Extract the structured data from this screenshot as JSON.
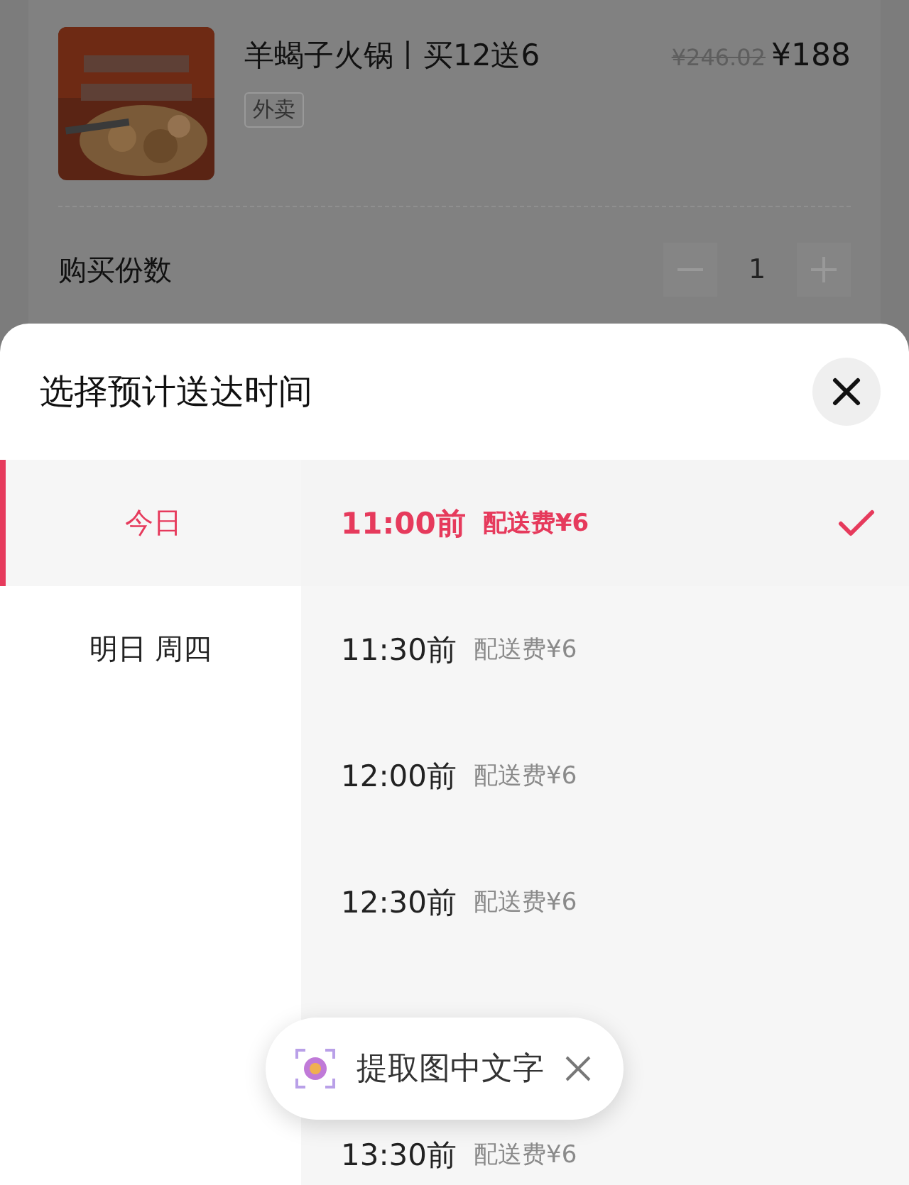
{
  "product": {
    "title": "羊蝎子火锅丨买12送6",
    "original_price": "¥246.02",
    "price": "¥188",
    "tag": "外卖"
  },
  "quantity": {
    "label": "购买份数",
    "value": "1"
  },
  "sheet": {
    "title": "选择预计送达时间",
    "days": [
      {
        "label": "今日",
        "selected": true
      },
      {
        "label": "明日 周四",
        "selected": false
      }
    ],
    "slots": [
      {
        "kind": "slot",
        "time": "11:00前",
        "fee": "配送费¥6",
        "selected": true
      },
      {
        "kind": "slot",
        "time": "11:30前",
        "fee": "配送费¥6",
        "selected": false
      },
      {
        "kind": "slot",
        "time": "12:00前",
        "fee": "配送费¥6",
        "selected": false
      },
      {
        "kind": "slot",
        "time": "12:30前",
        "fee": "配送费¥6",
        "selected": false
      },
      {
        "kind": "covered"
      },
      {
        "kind": "slot",
        "time": "13:30前",
        "fee": "配送费¥6",
        "selected": false
      }
    ]
  },
  "ocr_prompt": {
    "text": "提取图中文字"
  }
}
